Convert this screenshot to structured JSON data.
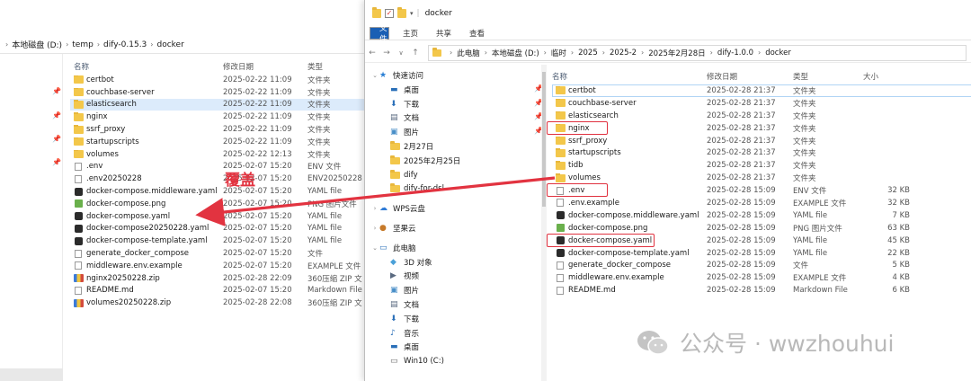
{
  "left_window": {
    "breadcrumb": [
      "本地磁盘 (D:)",
      "temp",
      "dify-0.15.3",
      "docker"
    ],
    "columns": {
      "name": "名称",
      "date": "修改日期",
      "type": "类型"
    },
    "files": [
      {
        "name": "certbot",
        "date": "2025-02-22 11:09",
        "type": "文件夹",
        "icon": "folder-icon"
      },
      {
        "name": "couchbase-server",
        "date": "2025-02-22 11:09",
        "type": "文件夹",
        "icon": "folder-icon"
      },
      {
        "name": "elasticsearch",
        "date": "2025-02-22 11:09",
        "type": "文件夹",
        "icon": "folder-icon",
        "selected": true
      },
      {
        "name": "nginx",
        "date": "2025-02-22 11:09",
        "type": "文件夹",
        "icon": "folder-icon"
      },
      {
        "name": "ssrf_proxy",
        "date": "2025-02-22 11:09",
        "type": "文件夹",
        "icon": "folder-icon"
      },
      {
        "name": "startupscripts",
        "date": "2025-02-22 11:09",
        "type": "文件夹",
        "icon": "folder-icon"
      },
      {
        "name": "volumes",
        "date": "2025-02-22 12:13",
        "type": "文件夹",
        "icon": "folder-icon"
      },
      {
        "name": ".env",
        "date": "2025-02-07 15:20",
        "type": "ENV 文件",
        "icon": "file-icon"
      },
      {
        "name": ".env20250228",
        "date": "2025-02-07 15:20",
        "type": "ENV20250228",
        "icon": "file-icon"
      },
      {
        "name": "docker-compose.middleware.yaml",
        "date": "2025-02-07 15:20",
        "type": "YAML file",
        "icon": "yaml-icon"
      },
      {
        "name": "docker-compose.png",
        "date": "2025-02-07 15:20",
        "type": "PNG 图片文件",
        "icon": "image-icon"
      },
      {
        "name": "docker-compose.yaml",
        "date": "2025-02-07 15:20",
        "type": "YAML file",
        "icon": "yaml-icon"
      },
      {
        "name": "docker-compose20250228.yaml",
        "date": "2025-02-07 15:20",
        "type": "YAML file",
        "icon": "yaml-icon"
      },
      {
        "name": "docker-compose-template.yaml",
        "date": "2025-02-07 15:20",
        "type": "YAML file",
        "icon": "yaml-icon"
      },
      {
        "name": "generate_docker_compose",
        "date": "2025-02-07 15:20",
        "type": "文件",
        "icon": "file-icon"
      },
      {
        "name": "middleware.env.example",
        "date": "2025-02-07 15:20",
        "type": "EXAMPLE 文件",
        "icon": "file-icon"
      },
      {
        "name": "nginx20250228.zip",
        "date": "2025-02-28 22:09",
        "type": "360压缩 ZIP 文",
        "icon": "zip-icon"
      },
      {
        "name": "README.md",
        "date": "2025-02-07 15:20",
        "type": "Markdown File",
        "icon": "markdown-icon"
      },
      {
        "name": "volumes20250228.zip",
        "date": "2025-02-28 22:08",
        "type": "360压缩 ZIP 文",
        "icon": "zip-icon"
      }
    ]
  },
  "right_window": {
    "title": "docker",
    "ribbon_tabs": [
      "文件",
      "主页",
      "共享",
      "查看"
    ],
    "breadcrumb": [
      "此电脑",
      "本地磁盘 (D:)",
      "临时",
      "2025",
      "2025-2",
      "2025年2月28日",
      "dify-1.0.0",
      "docker"
    ],
    "columns": {
      "name": "名称",
      "date": "修改日期",
      "type": "类型",
      "size": "大小"
    },
    "nav": [
      {
        "label": "快速访问",
        "icon": "star-icon",
        "level": 0,
        "expand": true
      },
      {
        "label": "桌面",
        "icon": "desktop-icon",
        "level": 1,
        "pinned": true
      },
      {
        "label": "下载",
        "icon": "download-icon",
        "level": 1,
        "pinned": true
      },
      {
        "label": "文档",
        "icon": "document-icon",
        "level": 1,
        "pinned": true
      },
      {
        "label": "图片",
        "icon": "picture-icon",
        "level": 1,
        "pinned": true
      },
      {
        "label": "2月27日",
        "icon": "folder-icon",
        "level": 1
      },
      {
        "label": "2025年2月25日",
        "icon": "folder-icon",
        "level": 1
      },
      {
        "label": "dify",
        "icon": "folder-icon",
        "level": 1
      },
      {
        "label": "dify-for-dsl",
        "icon": "folder-icon",
        "level": 1
      },
      {
        "label": "WPS云盘",
        "icon": "cloud-icon",
        "level": 0,
        "gap": true
      },
      {
        "label": "坚果云",
        "icon": "nut-icon",
        "level": 0,
        "gap": true
      },
      {
        "label": "此电脑",
        "icon": "computer-icon",
        "level": 0,
        "gap": true,
        "expand": true
      },
      {
        "label": "3D 对象",
        "icon": "cube-icon",
        "level": 1
      },
      {
        "label": "视频",
        "icon": "video-icon",
        "level": 1
      },
      {
        "label": "图片",
        "icon": "picture-icon",
        "level": 1
      },
      {
        "label": "文档",
        "icon": "document-icon",
        "level": 1
      },
      {
        "label": "下载",
        "icon": "download-icon",
        "level": 1
      },
      {
        "label": "音乐",
        "icon": "music-icon",
        "level": 1
      },
      {
        "label": "桌面",
        "icon": "desktop-icon",
        "level": 1
      },
      {
        "label": "Win10 (C:)",
        "icon": "drive-icon",
        "level": 1
      }
    ],
    "files": [
      {
        "name": "certbot",
        "date": "2025-02-28 21:37",
        "type": "文件夹",
        "size": "",
        "icon": "folder-icon",
        "focused": true
      },
      {
        "name": "couchbase-server",
        "date": "2025-02-28 21:37",
        "type": "文件夹",
        "size": "",
        "icon": "folder-icon"
      },
      {
        "name": "elasticsearch",
        "date": "2025-02-28 21:37",
        "type": "文件夹",
        "size": "",
        "icon": "folder-icon"
      },
      {
        "name": "nginx",
        "date": "2025-02-28 21:37",
        "type": "文件夹",
        "size": "",
        "icon": "folder-icon",
        "highlight": true
      },
      {
        "name": "ssrf_proxy",
        "date": "2025-02-28 21:37",
        "type": "文件夹",
        "size": "",
        "icon": "folder-icon"
      },
      {
        "name": "startupscripts",
        "date": "2025-02-28 21:37",
        "type": "文件夹",
        "size": "",
        "icon": "folder-icon"
      },
      {
        "name": "tidb",
        "date": "2025-02-28 21:37",
        "type": "文件夹",
        "size": "",
        "icon": "folder-icon"
      },
      {
        "name": "volumes",
        "date": "2025-02-28 21:37",
        "type": "文件夹",
        "size": "",
        "icon": "folder-icon"
      },
      {
        "name": ".env",
        "date": "2025-02-28 15:09",
        "type": "ENV 文件",
        "size": "32 KB",
        "icon": "file-icon",
        "highlight": true
      },
      {
        "name": ".env.example",
        "date": "2025-02-28 15:09",
        "type": "EXAMPLE 文件",
        "size": "32 KB",
        "icon": "file-icon"
      },
      {
        "name": "docker-compose.middleware.yaml",
        "date": "2025-02-28 15:09",
        "type": "YAML file",
        "size": "7 KB",
        "icon": "yaml-icon"
      },
      {
        "name": "docker-compose.png",
        "date": "2025-02-28 15:09",
        "type": "PNG 图片文件",
        "size": "63 KB",
        "icon": "image-icon"
      },
      {
        "name": "docker-compose.yaml",
        "date": "2025-02-28 15:09",
        "type": "YAML file",
        "size": "45 KB",
        "icon": "yaml-icon",
        "highlight": true
      },
      {
        "name": "docker-compose-template.yaml",
        "date": "2025-02-28 15:09",
        "type": "YAML file",
        "size": "22 KB",
        "icon": "yaml-icon"
      },
      {
        "name": "generate_docker_compose",
        "date": "2025-02-28 15:09",
        "type": "文件",
        "size": "5 KB",
        "icon": "file-icon"
      },
      {
        "name": "middleware.env.example",
        "date": "2025-02-28 15:09",
        "type": "EXAMPLE 文件",
        "size": "4 KB",
        "icon": "file-icon"
      },
      {
        "name": "README.md",
        "date": "2025-02-28 15:09",
        "type": "Markdown File",
        "size": "6 KB",
        "icon": "markdown-icon"
      }
    ]
  },
  "annotation": {
    "label": "覆盖",
    "color": "#e23340"
  },
  "watermark": {
    "text": "公众号 · wwzhouhui"
  },
  "colors": {
    "highlight_red": "#e0313f",
    "folder_yellow": "#f3c74a",
    "selection_blue": "#dcebfb",
    "ribbon_blue": "#1a5fb4"
  }
}
